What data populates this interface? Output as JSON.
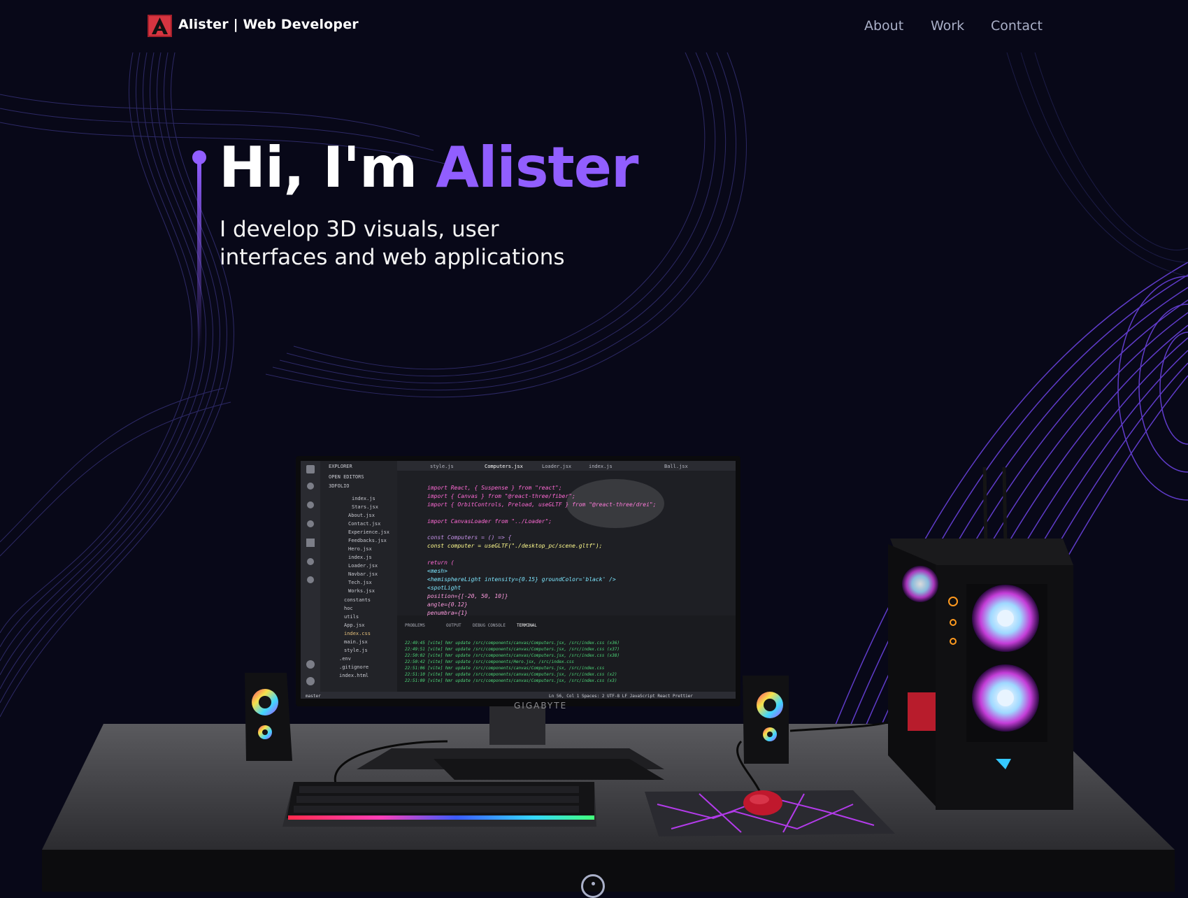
{
  "nav": {
    "brand": "Alister | Web Developer",
    "links": [
      "About",
      "Work",
      "Contact"
    ]
  },
  "hero": {
    "greeting": "Hi, I'm ",
    "name": "Alister",
    "subtitle": "I develop 3D visuals, user interfaces and web applications"
  },
  "editor": {
    "tabs": [
      "style.js",
      "Computers.jsx",
      "Loader.jsx",
      "index.js",
      "Ball.jsx"
    ],
    "files": [
      "index.js",
      "Stars.jsx",
      "About.jsx",
      "Contact.jsx",
      "Experience.jsx",
      "Feedbacks.jsx",
      "Hero.jsx",
      "index.js",
      "Loader.jsx",
      "Navbar.jsx",
      "Tech.jsx",
      "Works.jsx",
      "constants",
      "hoc",
      "utils",
      "App.jsx",
      "index.css",
      "main.jsx",
      "style.js",
      ".env",
      ".gitignore",
      "index.html"
    ],
    "code": [
      "import React, { Suspense } from \"react\";",
      "import { Canvas } from \"@react-three/fiber\";",
      "import { OrbitControls, Preload, useGLTF } from \"@react-three/drei\";",
      "",
      "import CanvasLoader from \"../Loader\";",
      "",
      "const Computers = () => {",
      "  const computer = useGLTF(\"./desktop_pc/scene.gltf\");",
      "",
      "  return (",
      "    <mesh>",
      "      <hemisphereLight intensity={0.15} groundColor='black' />",
      "      <spotLight",
      "        position={[-20, 50, 10]}",
      "        angle={0.12}",
      "        penumbra={1}"
    ],
    "panel_tabs": [
      "PROBLEMS",
      "OUTPUT",
      "DEBUG CONSOLE",
      "TERMINAL"
    ],
    "terminal": [
      "22:49:45 [vite] hmr update /src/components/canvas/Computers.jsx, /src/index.css (x36)",
      "22:49:51 [vite] hmr update /src/components/canvas/Computers.jsx, /src/index.css (x37)",
      "22:50:02 [vite] hmr update /src/components/canvas/Computers.jsx, /src/index.css (x38)",
      "22:50:42 [vite] hmr update /src/components/Hero.jsx, /src/index.css",
      "22:51:06 [vite] hmr update /src/components/canvas/Computers.jsx, /src/index.css",
      "22:51:10 [vite] hmr update /src/components/canvas/Computers.jsx, /src/index.css (x2)",
      "22:51:09 [vite] hmr update /src/components/canvas/Computers.jsx, /src/index.css (x3)"
    ],
    "status_left": "master",
    "status_right": "Ln 56, Col 1   Spaces: 2   UTF-8   LF   JavaScript React   Prettier"
  },
  "monitor_brand": "GIGABYTE",
  "colors": {
    "background": "#080818",
    "accent": "#915eff",
    "nav_link": "#aab0c8"
  },
  "icons": {
    "logo": "logo-icon",
    "scroll": "scroll-indicator-icon"
  }
}
